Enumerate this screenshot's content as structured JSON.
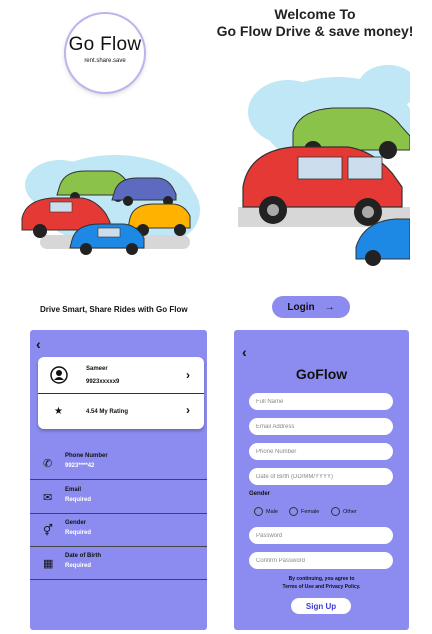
{
  "splash": {
    "logo_title": "Go Flow",
    "logo_subtitle": "rent.share.save",
    "tagline": "Drive Smart, Share Rides with Go Flow"
  },
  "welcome": {
    "line1": "Welcome To",
    "line2": "Go Flow Drive & save money!",
    "login_label": "Login"
  },
  "profile": {
    "name": "Sameer",
    "phone_masked": "9923xxxxx9",
    "rating": "4.54 My Rating",
    "fields": [
      {
        "label": "Phone Number",
        "value": "9923****42",
        "icon": "phone-icon"
      },
      {
        "label": "Email",
        "value": "Required",
        "icon": "mail-icon"
      },
      {
        "label": "Gender",
        "value": "Required",
        "icon": "gender-icon"
      },
      {
        "label": "Date of Birth",
        "value": "Required",
        "icon": "calendar-icon"
      }
    ]
  },
  "signup": {
    "title": "GoFlow",
    "placeholders": {
      "full_name": "Full Name",
      "email": "Email Address",
      "phone": "Phone Number",
      "dob": "Date of Birth (DD/MM/YYYY)",
      "password": "Password",
      "confirm": "Confirm Password"
    },
    "gender_label": "Gender",
    "gender_options": [
      "Male",
      "Female",
      "Other"
    ],
    "terms_line1": "By continuing, you agree to",
    "terms_line2": "Terms of Use and Privacy Policy.",
    "signup_label": "Sign Up"
  },
  "colors": {
    "accent": "#8c8cf0",
    "accent_text": "#3a3ad6"
  }
}
